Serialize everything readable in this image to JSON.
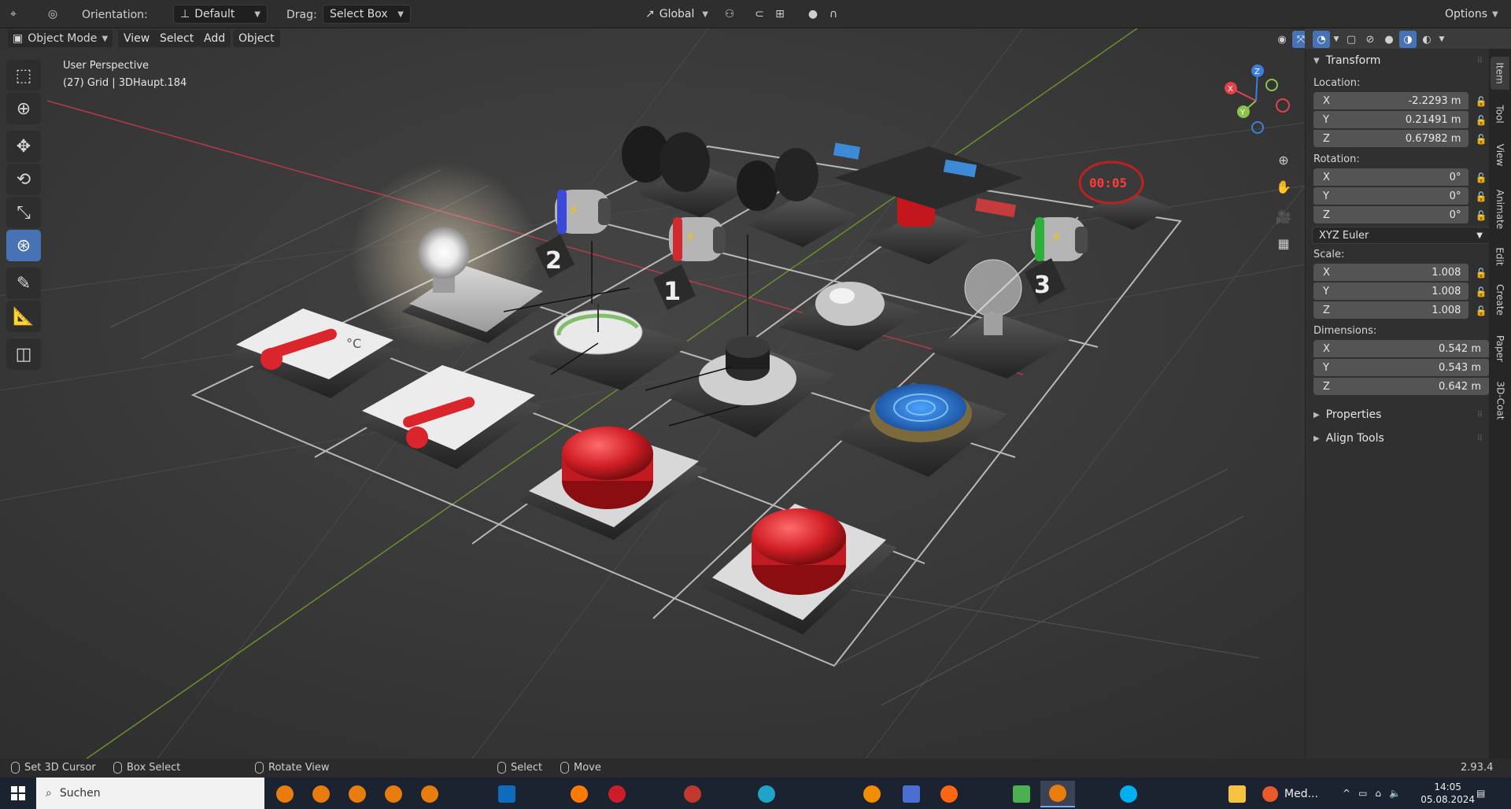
{
  "header": {
    "orientation_label": "Orientation:",
    "orientation_value": "Default",
    "drag_label": "Drag:",
    "drag_value": "Select Box",
    "transform_orientation": "Global",
    "options_label": "Options"
  },
  "viewport_header": {
    "mode": "Object Mode",
    "menus": [
      "View",
      "Select",
      "Add",
      "Object"
    ]
  },
  "viewport": {
    "perspective_label": "User Perspective",
    "object_info": "(27) Grid | 3DHaupt.184",
    "gizmo_axes": [
      "X",
      "Y",
      "Z"
    ],
    "tile_numbers": [
      "2",
      "1",
      "3"
    ],
    "timer_display": "00:05",
    "thermo_unit": "°C"
  },
  "toolbar": {
    "tools": [
      "select-box",
      "cursor",
      "move",
      "rotate",
      "scale",
      "transform",
      "annotate",
      "measure",
      "add-cube"
    ],
    "active_tool": "transform"
  },
  "npanel": {
    "transform_title": "Transform",
    "location_label": "Location:",
    "location": {
      "x": "-2.2293 m",
      "y": "0.21491 m",
      "z": "0.67982 m"
    },
    "rotation_label": "Rotation:",
    "rotation": {
      "x": "0°",
      "y": "0°",
      "z": "0°"
    },
    "rotation_mode": "XYZ Euler",
    "scale_label": "Scale:",
    "scale": {
      "x": "1.008",
      "y": "1.008",
      "z": "1.008"
    },
    "dimensions_label": "Dimensions:",
    "dimensions": {
      "x": "0.542 m",
      "y": "0.543 m",
      "z": "0.642 m"
    },
    "properties_title": "Properties",
    "align_tools_title": "Align Tools",
    "tabs": [
      "Item",
      "Tool",
      "View",
      "Animate",
      "Edit",
      "Create",
      "Paper",
      "3D-Coat"
    ]
  },
  "status": {
    "set_cursor": "Set 3D Cursor",
    "box_select": "Box Select",
    "rotate_view": "Rotate View",
    "select": "Select",
    "move": "Move",
    "version": "2.93.4"
  },
  "taskbar": {
    "search_placeholder": "Suchen",
    "media_label": "Med...",
    "time": "14:05",
    "date": "05.08.2024"
  },
  "colors": {
    "accent": "#4772b3",
    "x_axis": "#e0434d",
    "y_axis": "#8bc34a",
    "z_axis": "#3d7fdd"
  }
}
